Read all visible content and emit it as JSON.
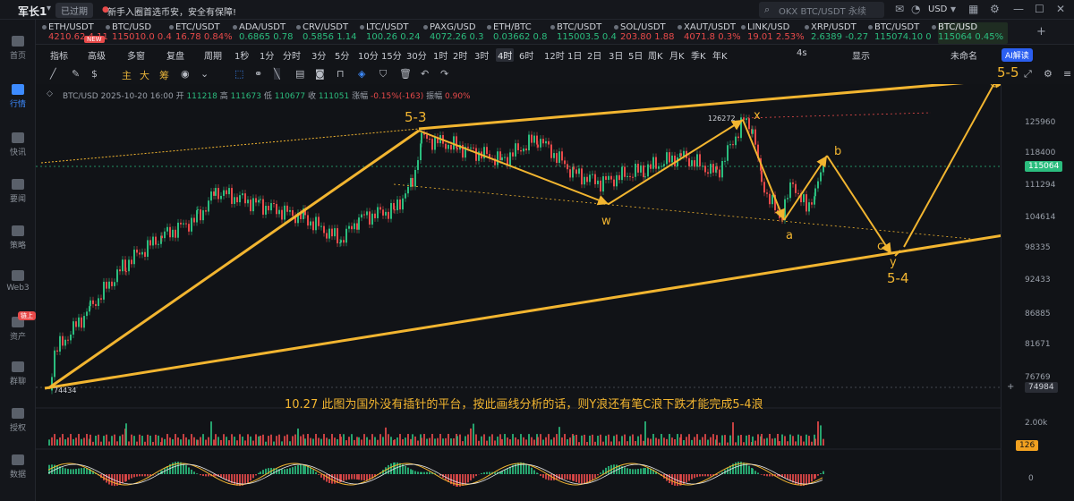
{
  "topbar": {
    "user": "军长1",
    "login_status": "已过期",
    "notice": "新手入圈首选币安，安全有保障!",
    "search_placeholder": "OKX BTC/USDT 永续",
    "currency": "USD"
  },
  "sidebar": {
    "items": [
      {
        "label": "首页",
        "icon": "home-icon"
      },
      {
        "label": "行情",
        "icon": "chart-icon",
        "active": true
      },
      {
        "label": "快讯",
        "icon": "news-icon"
      },
      {
        "label": "要闻",
        "icon": "article-icon"
      },
      {
        "label": "策略",
        "icon": "robot-icon"
      },
      {
        "label": "Web3",
        "icon": "web3-icon"
      },
      {
        "label": "资产",
        "icon": "wallet-icon",
        "badge": "链上"
      },
      {
        "label": "群聊",
        "icon": "chat-icon"
      },
      {
        "label": "授权",
        "icon": "key-icon"
      },
      {
        "label": "数据",
        "icon": "data-icon"
      }
    ]
  },
  "tickers": [
    {
      "name": "ETH/USDT",
      "price": "4210.62",
      "change": "4.11",
      "color": "#e84a4a",
      "tag": "NEW"
    },
    {
      "name": "BTC/USD",
      "price": "115010.0",
      "change": "0.4",
      "color": "#e84a4a"
    },
    {
      "name": "ETC/USDT",
      "price": "16.78",
      "change": "0.84%",
      "color": "#e84a4a"
    },
    {
      "name": "ADA/USDT",
      "price": "0.6865",
      "change": "0.78",
      "color": "#2bbd7e"
    },
    {
      "name": "CRV/USDT",
      "price": "0.5856",
      "change": "1.14",
      "color": "#2bbd7e"
    },
    {
      "name": "LTC/USDT",
      "price": "100.26",
      "change": "0.24",
      "color": "#2bbd7e"
    },
    {
      "name": "PAXG/USD",
      "price": "4072.26",
      "change": "0.3",
      "color": "#2bbd7e"
    },
    {
      "name": "ETH/BTC",
      "price": "0.03662",
      "change": "0.8",
      "color": "#2bbd7e"
    },
    {
      "name": "BTC/USDT",
      "price": "115003.5",
      "change": "0.4",
      "color": "#2bbd7e"
    },
    {
      "name": "SOL/USDT",
      "price": "203.80",
      "change": "1.88",
      "color": "#e84a4a"
    },
    {
      "name": "XAUT/USDT",
      "price": "4071.8",
      "change": "0.3%",
      "color": "#e84a4a"
    },
    {
      "name": "LINK/USD",
      "price": "19.01",
      "change": "2.53%",
      "color": "#e84a4a"
    },
    {
      "name": "XRP/USDT",
      "price": "2.6389",
      "change": "-0.27",
      "color": "#2bbd7e"
    },
    {
      "name": "BTC/USDT",
      "price": "115074.10",
      "change": "0",
      "color": "#2bbd7e"
    },
    {
      "name": "BTC/USD",
      "price": "115064",
      "change": "0.45%",
      "color": "#2bbd7e",
      "active": true
    }
  ],
  "toolbar": {
    "items": [
      "指标",
      "高级",
      "多窗",
      "复盘",
      "周期",
      "1秒",
      "1分",
      "分时",
      "3分",
      "5分",
      "10分",
      "15分",
      "30分",
      "1时",
      "2时",
      "3时",
      "4时",
      "6时",
      "12时",
      "1日",
      "2日",
      "3日",
      "5日",
      "周K",
      "月K",
      "季K",
      "年K"
    ],
    "active_period": "4时",
    "right_items": [
      "4s",
      "显示",
      "未命名"
    ],
    "ai_label": "AI解读"
  },
  "drawtools": {
    "letters": [
      "主",
      "大",
      "筹"
    ]
  },
  "chart_info": {
    "symbol": "BTC/USD",
    "datetime": "2025-10-20 16:00",
    "open_label": "开",
    "open": "111218",
    "high_label": "高",
    "high": "111673",
    "low_label": "低",
    "low": "110677",
    "close_label": "收",
    "close": "111051",
    "change_label": "涨幅",
    "change": "-0.15%(-163)",
    "amp_label": "振幅",
    "amp": "0.90%"
  },
  "price_axis": {
    "labels": [
      "125960",
      "118400",
      "111294",
      "104614",
      "98335",
      "92433",
      "86885",
      "81671",
      "76769"
    ],
    "current": "115064",
    "low_marker": "74984",
    "vol_label": "2.00k",
    "vol_current": "126",
    "macd_zero": "0",
    "current_color": "#2bbd7e",
    "low_color": "#2a2d35",
    "vol_color": "#f0a020"
  },
  "annotations": {
    "w53": "5-3",
    "x": "x",
    "w": "w",
    "a": "a",
    "b": "b",
    "c": "c",
    "y": "y",
    "w54": "5-4",
    "w55": "5-5",
    "peak_price": "126272",
    "low_price": "74434",
    "caption": "10.27 此图为国外没有插针的平台，按此画线分析的话，则Y浪还有笔C浪下跌才能完成5-4浪",
    "line_color": "#f2b530"
  }
}
